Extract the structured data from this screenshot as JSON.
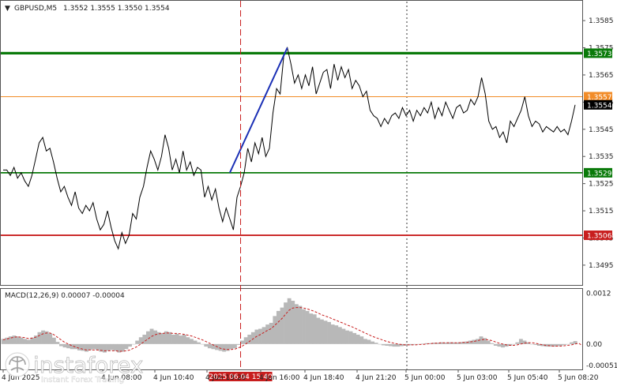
{
  "header": {
    "symbol": "GBPUSD,M5",
    "ohlc": "1.3552 1.3555 1.3550 1.3554",
    "macd_label": "MACD(12,26,9) 0.00007 -0.00004"
  },
  "watermark": {
    "brand": "instaforex",
    "tagline": "Instant Forex Trading"
  },
  "colors": {
    "green": "#0a7a0a",
    "orange": "#f28c28",
    "red": "#c81e1e",
    "blue": "#1a2fb5",
    "price": "#000000",
    "hist": "#b8b8b8",
    "signal": "#c81e1e"
  },
  "chart_data": [
    {
      "type": "line",
      "title": "GBPUSD,M5",
      "ylim": [
        1.3488,
        1.3592
      ],
      "yticks": [
        "1.3585",
        "1.3575",
        "1.3565",
        "1.3555",
        "1.3545",
        "1.3535",
        "1.3525",
        "1.3515",
        "1.3505",
        "1.3495"
      ],
      "grid": "vertical dotted",
      "levels": [
        {
          "label": "1.3573",
          "value": 1.3573,
          "color": "#0a7a0a",
          "style": "thick"
        },
        {
          "label": "1.3557",
          "value": 1.3557,
          "color": "#f28c28",
          "style": "thin"
        },
        {
          "label": "1.3554",
          "value": 1.3554,
          "color": "#000000",
          "style": "current"
        },
        {
          "label": "1.3529",
          "value": 1.3529,
          "color": "#0a7a0a",
          "style": "medium"
        },
        {
          "label": "1.3506",
          "value": 1.3506,
          "color": "#c81e1e",
          "style": "medium"
        }
      ],
      "series": [
        {
          "values": [
            1.353,
            1.353,
            1.3528,
            1.3531,
            1.3527,
            1.3529,
            1.3526,
            1.3524,
            1.3528,
            1.3534,
            1.354,
            1.3542,
            1.3537,
            1.3538,
            1.3533,
            1.3527,
            1.3522,
            1.3524,
            1.352,
            1.3517,
            1.3522,
            1.3516,
            1.3514,
            1.3517,
            1.3515,
            1.3518,
            1.3512,
            1.3508,
            1.351,
            1.3515,
            1.3509,
            1.3504,
            1.3501,
            1.3507,
            1.3503,
            1.3506,
            1.3514,
            1.3512,
            1.352,
            1.3524,
            1.3531,
            1.3537,
            1.3534,
            1.353,
            1.3535,
            1.3543,
            1.3538,
            1.353,
            1.3534,
            1.3529,
            1.3537,
            1.353,
            1.3533,
            1.3528,
            1.3531,
            1.353,
            1.352,
            1.3524,
            1.3519,
            1.3523,
            1.3516,
            1.3511,
            1.3516,
            1.3512,
            1.3508,
            1.352,
            1.3524,
            1.3529,
            1.3538,
            1.3533,
            1.354,
            1.3536,
            1.3542,
            1.3535,
            1.3538,
            1.3551,
            1.356,
            1.3558,
            1.3572,
            1.3575,
            1.3569,
            1.3562,
            1.3565,
            1.356,
            1.3565,
            1.3561,
            1.3568,
            1.3558,
            1.3562,
            1.3566,
            1.3567,
            1.356,
            1.3569,
            1.3563,
            1.3568,
            1.3564,
            1.3567,
            1.356,
            1.3563,
            1.3561,
            1.3557,
            1.3559,
            1.3552,
            1.355,
            1.3549,
            1.3546,
            1.3549,
            1.3547,
            1.355,
            1.3551,
            1.3549,
            1.3553,
            1.355,
            1.3552,
            1.3548,
            1.3552,
            1.355,
            1.3553,
            1.3551,
            1.3555,
            1.3549,
            1.3553,
            1.355,
            1.3555,
            1.3552,
            1.3549,
            1.3553,
            1.3554,
            1.3551,
            1.3552,
            1.3556,
            1.3554,
            1.3557,
            1.3564,
            1.3558,
            1.3548,
            1.3545,
            1.3546,
            1.3542,
            1.3544,
            1.354,
            1.3548,
            1.3546,
            1.3549,
            1.3552,
            1.3557,
            1.355,
            1.3546,
            1.3548,
            1.3547,
            1.3544,
            1.3546,
            1.3545,
            1.3544,
            1.3546,
            1.3544,
            1.3545,
            1.3543,
            1.3548,
            1.3554
          ],
          "color": "#000000"
        }
      ],
      "annotations": [
        {
          "type": "arrow",
          "from_index": 63,
          "to_index": 79,
          "from_value": 1.3529,
          "to_value": 1.3575,
          "color": "#1a2fb5"
        },
        {
          "type": "vline",
          "index": 66,
          "color": "#c81e1e",
          "style": "dashed",
          "label": "2025.06.04 15:40"
        }
      ],
      "x_tick_labels": [
        "4 Jun 2025",
        "4 Jun 08:00",
        "4 Jun 10:40",
        "4 Jun 13:20",
        "4 Jun 16:00",
        "4 Jun 18:40",
        "4 Jun 21:20",
        "5 Jun 00:00",
        "5 Jun 03:00",
        "5 Jun 05:40",
        "5 Jun 08:20"
      ]
    },
    {
      "type": "bar",
      "title": "MACD(12,26,9) 0.00007 -0.00004",
      "ylim": [
        -0.00058,
        0.0013
      ],
      "yticks": [
        "0.0012",
        "0.00",
        "-0.00051"
      ],
      "series": [
        {
          "name": "histogram",
          "values": [
            0.00012,
            0.00015,
            0.00018,
            0.0002,
            0.00018,
            0.00015,
            0.00012,
            0.0001,
            0.00015,
            0.0002,
            0.00028,
            0.00032,
            0.0003,
            0.00025,
            0.00015,
            5e-05,
            -5e-05,
            -8e-05,
            -0.0001,
            -0.00012,
            -0.00012,
            -0.00015,
            -0.00016,
            -0.00018,
            -0.00014,
            -0.00012,
            -0.00014,
            -0.00018,
            -0.0002,
            -0.00016,
            -0.00014,
            -0.00016,
            -0.0002,
            -0.00018,
            -0.00012,
            -6e-05,
            0.0,
            8e-05,
            0.00016,
            0.00022,
            0.0003,
            0.00036,
            0.00032,
            0.00028,
            0.00026,
            0.0003,
            0.00028,
            0.00022,
            0.00024,
            0.0002,
            0.00022,
            0.00016,
            0.00012,
            8e-05,
            4e-05,
            0.0,
            -6e-05,
            -0.0001,
            -0.00012,
            -0.00014,
            -0.00016,
            -0.00018,
            -0.00016,
            -0.00012,
            -0.0001,
            -2e-05,
            8e-05,
            0.00016,
            0.00022,
            0.00028,
            0.00034,
            0.00036,
            0.0004,
            0.00046,
            0.0005,
            0.00066,
            0.00078,
            0.00086,
            0.00098,
            0.00108,
            0.00102,
            0.00094,
            0.0009,
            0.00082,
            0.00078,
            0.00072,
            0.0007,
            0.00062,
            0.00058,
            0.00055,
            0.00052,
            0.00046,
            0.00044,
            0.0004,
            0.00036,
            0.00032,
            0.0003,
            0.00026,
            0.00022,
            0.00018,
            0.00012,
            0.0001,
            6e-05,
            3e-05,
            0.0,
            -3e-05,
            -4e-05,
            -5e-05,
            -6e-05,
            -6e-05,
            -5e-05,
            -4e-05,
            -3e-05,
            -2e-05,
            -1e-05,
            0.0,
            1e-05,
            2e-05,
            2e-05,
            3e-05,
            3e-05,
            4e-05,
            3e-05,
            4e-05,
            4e-05,
            3e-05,
            4e-05,
            5e-05,
            6e-05,
            8e-05,
            0.0001,
            0.00012,
            0.00018,
            0.00014,
            8e-05,
            2e-05,
            -4e-05,
            -6e-05,
            -8e-05,
            -6e-05,
            -4e-05,
            0.0,
            4e-05,
            0.00012,
            8e-05,
            4e-05,
            0.0,
            -2e-05,
            -4e-05,
            -5e-05,
            -6e-05,
            -6e-05,
            -6e-05,
            -5e-05,
            -4e-05,
            -2e-05,
            0.0,
            4e-05,
            7e-05
          ]
        },
        {
          "name": "signal",
          "values": [
            0.0001,
            0.00012,
            0.00014,
            0.00016,
            0.00017,
            0.00016,
            0.00015,
            0.00013,
            0.00014,
            0.00016,
            0.0002,
            0.00024,
            0.00026,
            0.00026,
            0.00022,
            0.00016,
            0.0001,
            4e-05,
            0.0,
            -4e-05,
            -7e-05,
            -0.0001,
            -0.00012,
            -0.00014,
            -0.00014,
            -0.00014,
            -0.00014,
            -0.00015,
            -0.00016,
            -0.00016,
            -0.00016,
            -0.00016,
            -0.00017,
            -0.00017,
            -0.00016,
            -0.00014,
            -0.0001,
            -6e-05,
            0.0,
            6e-05,
            0.00012,
            0.00018,
            0.00022,
            0.00024,
            0.00025,
            0.00026,
            0.00026,
            0.00025,
            0.00025,
            0.00024,
            0.00023,
            0.00021,
            0.00019,
            0.00016,
            0.00013,
            0.0001,
            6e-05,
            2e-05,
            -2e-05,
            -6e-05,
            -0.0001,
            -0.00012,
            -0.00013,
            -0.00013,
            -0.00012,
            -9e-05,
            -5e-05,
            0.0,
            6e-05,
            0.00012,
            0.00018,
            0.00022,
            0.00027,
            0.00032,
            0.00036,
            0.00044,
            0.00052,
            0.0006,
            0.0007,
            0.0008,
            0.00085,
            0.00086,
            0.00086,
            0.00085,
            0.00083,
            0.0008,
            0.00077,
            0.00073,
            0.00069,
            0.00066,
            0.00063,
            0.00059,
            0.00056,
            0.00052,
            0.00049,
            0.00045,
            0.00042,
            0.00038,
            0.00034,
            0.0003,
            0.00026,
            0.00022,
            0.00018,
            0.00015,
            0.00012,
            9e-05,
            6e-05,
            4e-05,
            2e-05,
            0.0,
            -1e-05,
            -2e-05,
            -2e-05,
            -2e-05,
            -2e-05,
            -1e-05,
            -1e-05,
            0.0,
            1e-05,
            2e-05,
            2e-05,
            3e-05,
            3e-05,
            3e-05,
            3e-05,
            3e-05,
            3e-05,
            4e-05,
            4e-05,
            5e-05,
            6e-05,
            8e-05,
            0.0001,
            0.00011,
            0.0001,
            8e-05,
            5e-05,
            2e-05,
            0.0,
            -2e-05,
            -3e-05,
            -3e-05,
            -2e-05,
            0.0,
            2e-05,
            3e-05,
            3e-05,
            2e-05,
            0.0,
            -2e-05,
            -3e-05,
            -4e-05,
            -5e-05,
            -5e-05,
            -5e-05,
            -4e-05,
            -3e-05,
            -2e-05,
            0.0,
            2e-05,
            -4e-05
          ],
          "color": "#c81e1e"
        }
      ]
    }
  ]
}
